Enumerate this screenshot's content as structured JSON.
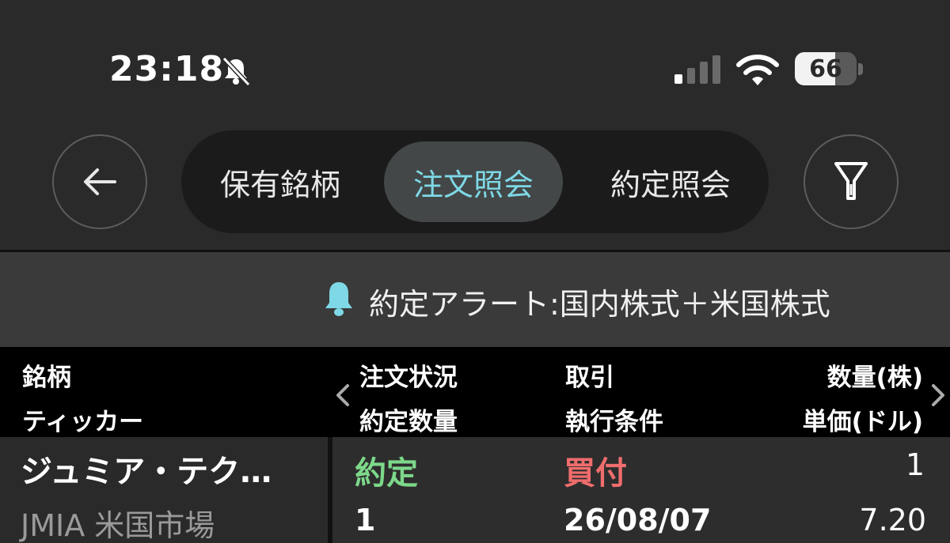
{
  "status_bar": {
    "time": "23:18",
    "battery": "66",
    "battery_level": 0.66,
    "icons": [
      "bell-slash-icon",
      "cellular-signal-icon",
      "wifi-icon",
      "battery-icon"
    ]
  },
  "nav": {
    "back_icon": "arrow-left-icon",
    "filter_icon": "filter-icon",
    "tabs": [
      {
        "label": "保有銘柄",
        "active": false
      },
      {
        "label": "注文照会",
        "active": true
      },
      {
        "label": "約定照会",
        "active": false
      }
    ]
  },
  "alert": {
    "icon": "bell-icon",
    "text": "約定アラート:国内株式＋米国株式"
  },
  "table": {
    "headers": {
      "name": "銘柄",
      "ticker": "ティッカー",
      "status": "注文状況",
      "filled": "約定数量",
      "side": "取引",
      "condition": "執行条件",
      "qty": "数量(株)",
      "price": "単価(ドル)"
    },
    "rows": [
      {
        "name": "ジュミア・テク…",
        "ticker": "JMIA 米国市場",
        "status": "約定",
        "side": "買付",
        "qty": "1",
        "filled": "1",
        "date": "26/08/07",
        "price": "7.20"
      }
    ]
  },
  "colors": {
    "background": "#2a2a2a",
    "accent_tab": "#7ed8e6",
    "status_green": "#7dd88a",
    "buy_red": "#ef6d6d"
  }
}
